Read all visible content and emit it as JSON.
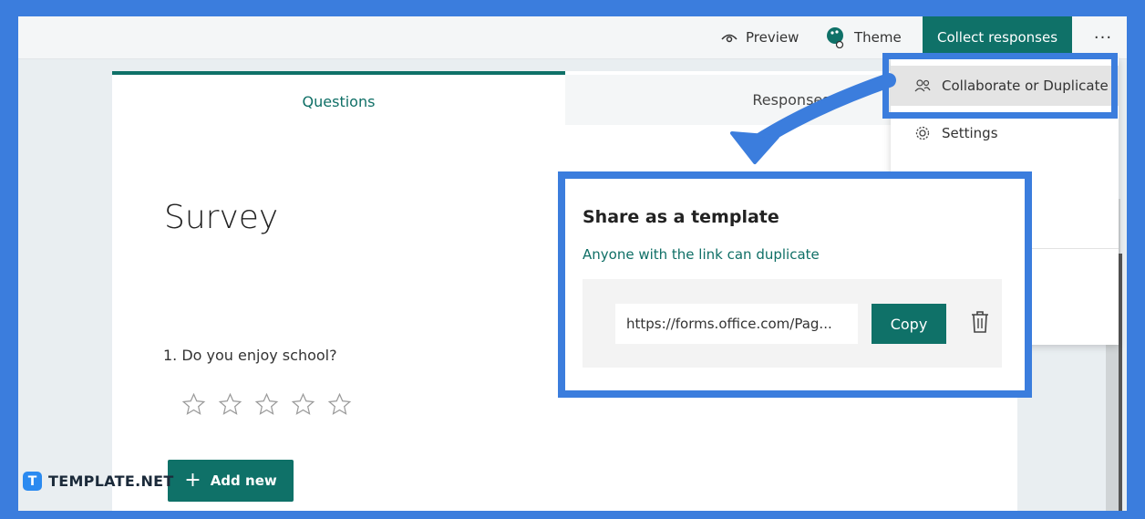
{
  "topbar": {
    "preview_label": "Preview",
    "theme_label": "Theme",
    "collect_label": "Collect responses",
    "more_label": "···"
  },
  "tabs": {
    "questions_label": "Questions",
    "responses_label": "Responses"
  },
  "form": {
    "title": "Survey",
    "question": "1. Do you enjoy school?",
    "rating_stars": 5,
    "add_new_label": "Add new"
  },
  "menu": {
    "collaborate_label": "Collaborate or Duplicate",
    "settings_label": "Settings"
  },
  "share": {
    "title": "Share as a template",
    "subtitle": "Anyone with the link can duplicate",
    "link_value": "https://forms.office.com/Pag...",
    "copy_label": "Copy"
  },
  "watermark": {
    "badge": "T",
    "text": "TEMPLATE.NET"
  },
  "colors": {
    "accent": "#0f7168",
    "highlight": "#3b7ddd"
  }
}
